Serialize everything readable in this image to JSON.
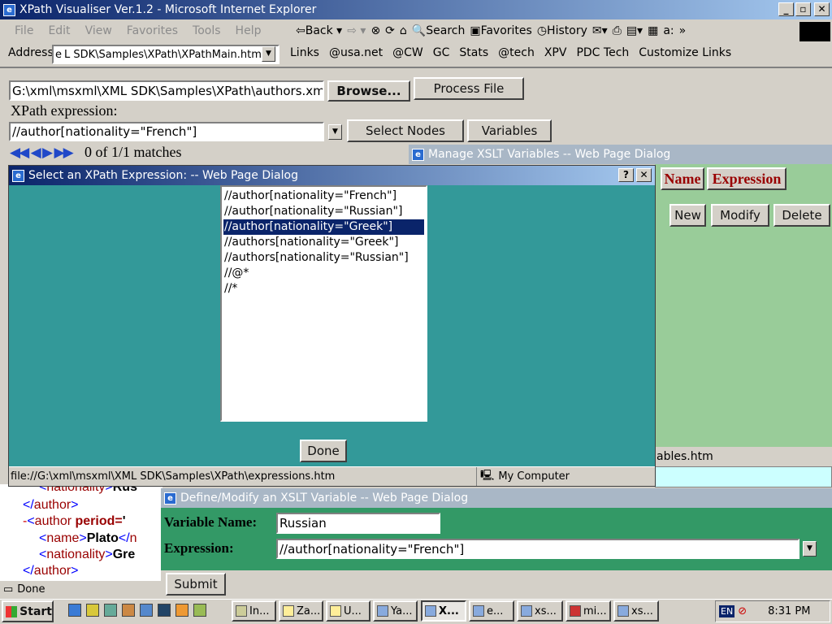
{
  "window": {
    "title": "XPath Visualiser Ver.1.2 - Microsoft Internet Explorer"
  },
  "menu": [
    "File",
    "Edit",
    "View",
    "Favorites",
    "Tools",
    "Help"
  ],
  "toolbar": {
    "back": "Back",
    "search": "Search",
    "favorites": "Favorites",
    "history": "History"
  },
  "address": {
    "label": "Address",
    "value": "L SDK\\Samples\\XPath\\XPathMain.htm"
  },
  "links": {
    "label": "Links",
    "items": [
      "@usa.net",
      "@CW",
      "GC",
      "Stats",
      "@tech",
      "XPV",
      "PDC Tech",
      "Customize Links"
    ]
  },
  "main": {
    "file_path": "G:\\xml\\msxml\\XML SDK\\Samples\\XPath\\authors.xml",
    "browse_label": "Browse...",
    "process_label": "Process File",
    "xpath_label": "XPath expression:",
    "xpath_value": "//author[nationality=\"French\"]",
    "select_nodes_label": "Select Nodes",
    "variables_label": "Variables",
    "matches": "0 of 1/1 matches"
  },
  "xml_view": {
    "lines": [
      "<nationality>Rus",
      "</author>",
      "-<author period='",
      "<name>Plato</n",
      "<nationality>Gre",
      "</author>"
    ]
  },
  "status_main": {
    "text": "Done"
  },
  "manage_dialog": {
    "title": "Manage XSLT Variables -- Web Page Dialog",
    "col_name": "Name",
    "col_expression": "Expression",
    "new_label": "New",
    "modify_label": "Modify",
    "delete_label": "Delete",
    "status_text": "ables.htm"
  },
  "select_dialog": {
    "title": "Select an XPath Expression: -- Web Page Dialog",
    "help": "?",
    "close": "✕",
    "options": [
      "//author[nationality=\"French\"]",
      "//author[nationality=\"Russian\"]",
      "//author[nationality=\"Greek\"]",
      "//authors[nationality=\"Greek\"]",
      "//authors[nationality=\"Russian\"]",
      "//@*",
      "//*"
    ],
    "selected_index": 2,
    "done_label": "Done",
    "status_url": "file://G:\\xml\\msxml\\XML SDK\\Samples\\XPath\\expressions.htm",
    "zone": "My Computer"
  },
  "define_dialog": {
    "title": "Define/Modify an XSLT Variable -- Web Page Dialog",
    "var_label": "Variable Name:",
    "var_value": "Russian",
    "expr_label": "Expression:",
    "expr_value": "//author[nationality=\"French\"]",
    "submit_label": "Submit"
  },
  "taskbar": {
    "start": "Start",
    "items": [
      "In...",
      "Za...",
      "U...",
      "Ya...",
      "X...",
      "e...",
      "xs...",
      "mi...",
      "xs..."
    ],
    "lang": "EN",
    "clock": "8:31 PM"
  },
  "colors": {
    "teal": "#339999",
    "green": "#99cc99",
    "dkgreen": "#339966",
    "navy": "#0a246a"
  }
}
